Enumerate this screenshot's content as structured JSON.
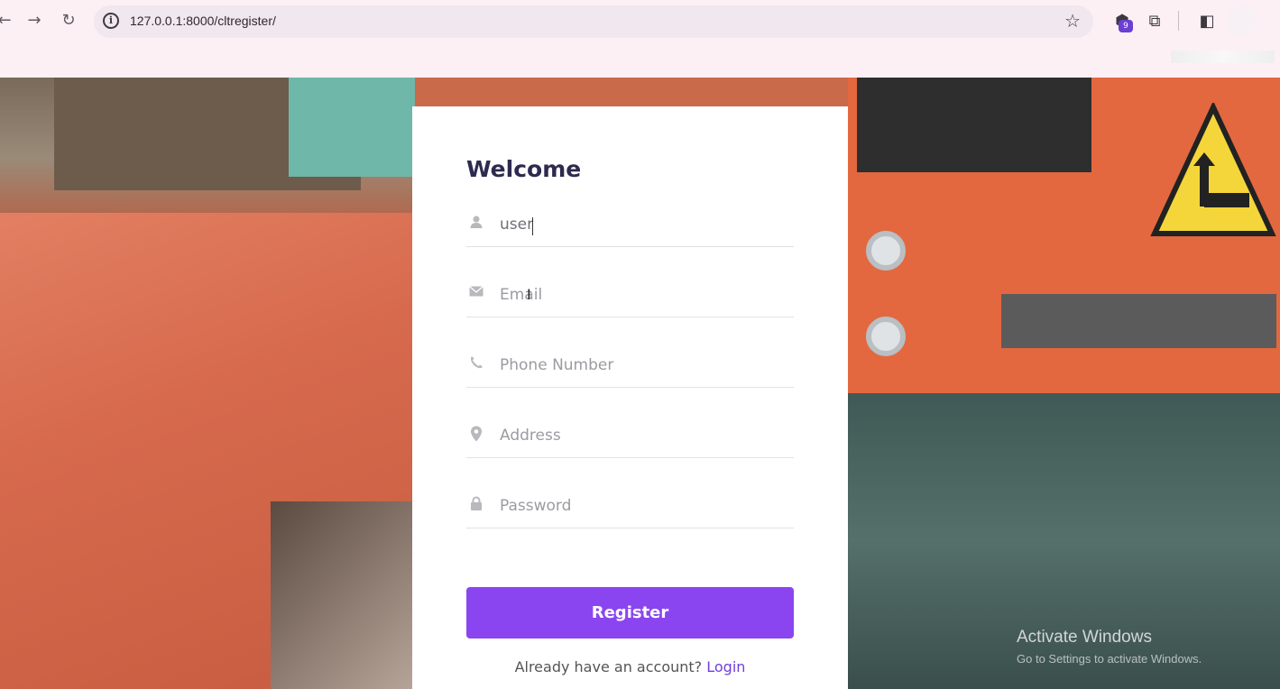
{
  "browser": {
    "back_icon": "arrow-left-icon",
    "forward_icon": "arrow-right-icon",
    "reload_icon": "reload-icon",
    "url": "127.0.0.1:8000/cltregister/",
    "bookmark_icon": "star-icon",
    "extension_badge": "9"
  },
  "form": {
    "title": "Welcome",
    "fields": [
      {
        "icon": "user-icon",
        "value": "user",
        "placeholder": ""
      },
      {
        "icon": "envelope-icon",
        "value": "",
        "placeholder": "Email"
      },
      {
        "icon": "phone-icon",
        "value": "",
        "placeholder": "Phone Number"
      },
      {
        "icon": "map-pin-icon",
        "value": "",
        "placeholder": "Address"
      },
      {
        "icon": "lock-icon",
        "value": "",
        "placeholder": "Password"
      }
    ],
    "register_label": "Register",
    "login_prompt": "Already have an account?",
    "login_label": "Login"
  },
  "os": {
    "activate_title": "Activate Windows",
    "activate_sub": "Go to Settings to activate Windows."
  },
  "colors": {
    "accent": "#8a45f0",
    "title": "#2e2a4f",
    "link": "#6f3fdc"
  }
}
